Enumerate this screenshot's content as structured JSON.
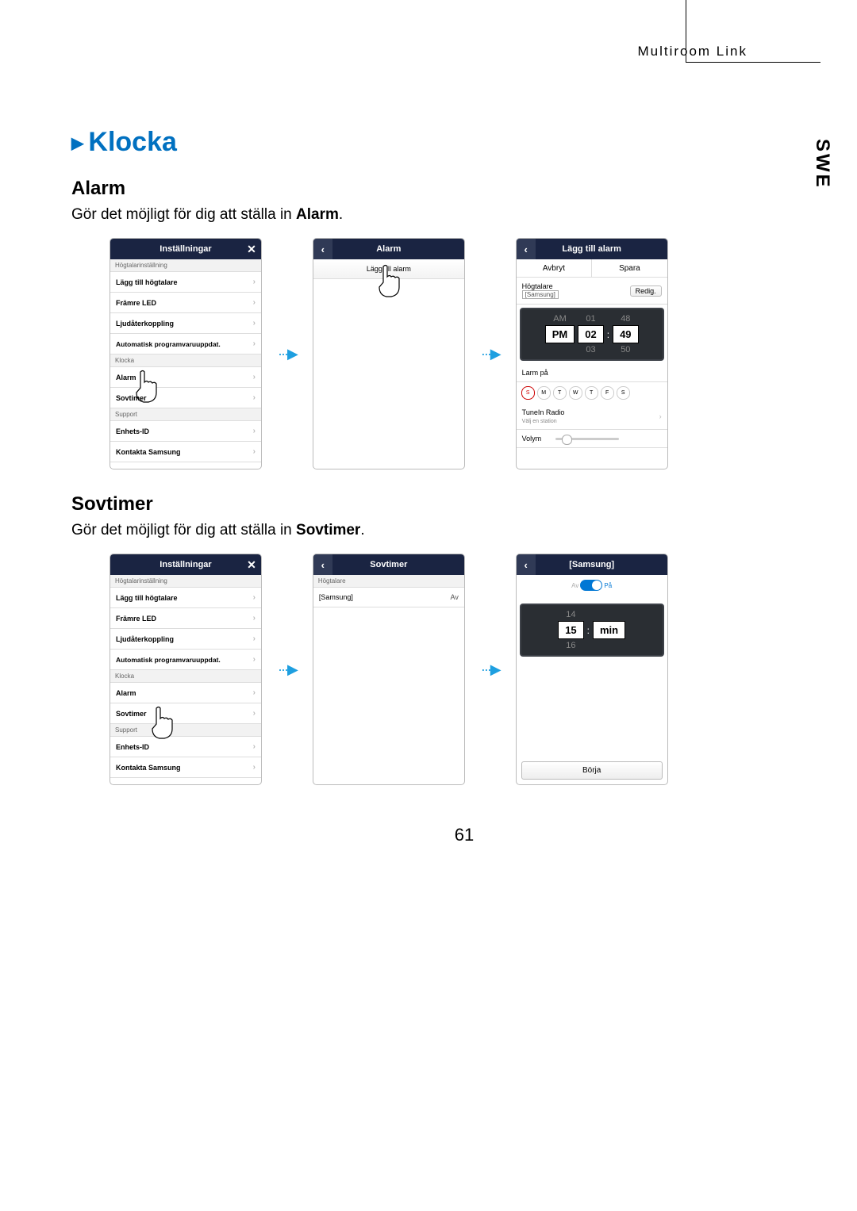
{
  "header": {
    "title": "Multiroom Link",
    "lang": "SWE"
  },
  "h1": "Klocka",
  "alarm": {
    "title": "Alarm",
    "desc_pre": "Gör det möjligt för dig att ställa in ",
    "desc_bold": "Alarm",
    "desc_post": "."
  },
  "sovtimer": {
    "title": "Sovtimer",
    "desc_pre": "Gör det möjligt för dig att ställa in ",
    "desc_bold": "Sovtimer",
    "desc_post": "."
  },
  "settings": {
    "title": "Inställningar",
    "sec1": "Högtalarinställning",
    "add_speaker": "Lägg till högtalare",
    "front_led": "Främre LED",
    "audio_return": "Ljudåterkoppling",
    "auto_update": "Automatisk programvaruuppdat.",
    "sec2": "Klocka",
    "alarm": "Alarm",
    "sovtimer": "Sovtimer",
    "sec3": "Support",
    "device_id": "Enhets-ID",
    "contact": "Kontakta Samsung"
  },
  "screen_alarm_list": {
    "title": "Alarm",
    "add": "Lägg till alarm"
  },
  "screen_add_alarm": {
    "title": "Lägg till alarm",
    "cancel": "Avbryt",
    "save": "Spara",
    "speaker": "Högtalare",
    "speaker_val": "[Samsung]",
    "edit": "Redig.",
    "am": "AM",
    "pm": "PM",
    "h_dim1": "01",
    "h_sel": "02",
    "h_dim2": "03",
    "m_dim1": "48",
    "m_sel": "49",
    "m_dim2": "50",
    "alarm_on": "Larm på",
    "days": [
      "S",
      "M",
      "T",
      "W",
      "T",
      "F",
      "S"
    ],
    "tunein": "TuneIn Radio",
    "tunein_sub": "Välj en station",
    "volume": "Volym"
  },
  "screen_sov_list": {
    "title": "Sovtimer",
    "sec": "Högtalare",
    "name": "[Samsung]",
    "state": "Av"
  },
  "screen_sov_detail": {
    "title": "[Samsung]",
    "off": "Av",
    "on": "På",
    "v_dim1": "14",
    "v_sel": "15",
    "v_dim2": "16",
    "unit": "min",
    "start": "Börja"
  },
  "page_number": "61"
}
